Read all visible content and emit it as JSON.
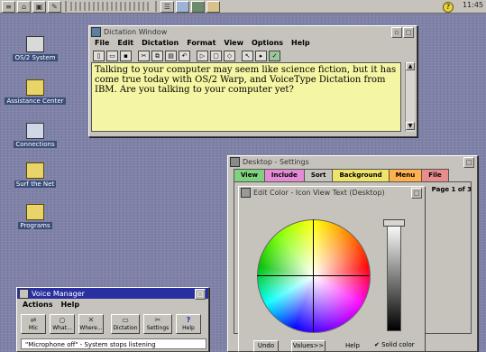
{
  "launchpad": {
    "buttons": [
      "≡",
      "⌂",
      "▣",
      "✎",
      "☰"
    ],
    "help": "?",
    "clock": "11:45"
  },
  "desktop_icons": [
    {
      "label": "OS/2 System"
    },
    {
      "label": "Assistance Center"
    },
    {
      "label": "Connections"
    },
    {
      "label": "Surf the Net"
    },
    {
      "label": "Programs"
    }
  ],
  "dictation": {
    "title": "Dictation Window",
    "menus": [
      "File",
      "Edit",
      "Dictation",
      "Format",
      "View",
      "Options",
      "Help"
    ],
    "text": "Talking to your computer may seem like science fiction, but it has come true today with OS/2 Warp, and VoiceType Dictation from IBM. Are you talking to your computer yet?"
  },
  "settings": {
    "title": "Desktop - Settings",
    "tabs": [
      {
        "label": "View",
        "color": "#7fd17f"
      },
      {
        "label": "Include",
        "color": "#e58ad4"
      },
      {
        "label": "Sort",
        "color": "#c6c3bd"
      },
      {
        "label": "Background",
        "color": "#efe36a"
      },
      {
        "label": "Menu",
        "color": "#ffb04f"
      },
      {
        "label": "File",
        "color": "#e88c8c"
      }
    ],
    "page_indicator": "Page 1 of 3"
  },
  "edit_color": {
    "title": "Edit Color - Icon View Text (Desktop)",
    "buttons": {
      "undo": "Undo",
      "values": "Values>>",
      "help": "Help"
    },
    "checkbox": "Solid color"
  },
  "voice_manager": {
    "title": "Voice Manager",
    "menus": [
      "Actions",
      "Help"
    ],
    "buttons": [
      {
        "label": "Mic",
        "glyph": "⇌"
      },
      {
        "label": "What...",
        "glyph": "○"
      },
      {
        "label": "Where...",
        "glyph": "✕"
      },
      {
        "label": "Dictation",
        "glyph": "▭"
      },
      {
        "label": "Settings",
        "glyph": "✂"
      },
      {
        "label": "Help",
        "glyph": "?"
      }
    ],
    "status": "\"Microphone off\" - System stops listening"
  }
}
